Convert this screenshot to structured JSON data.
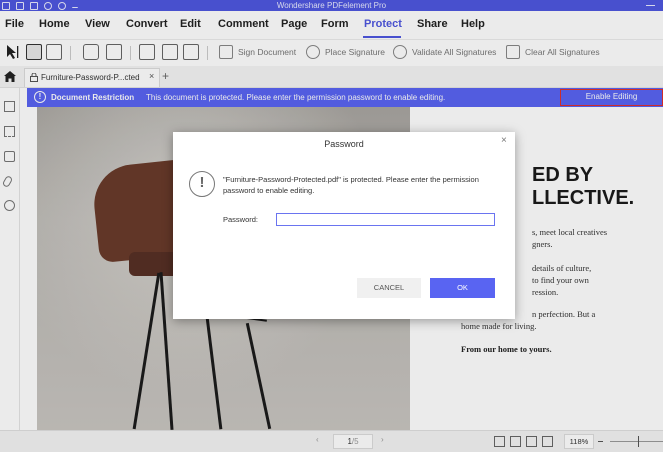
{
  "app": {
    "title": "Wondershare PDFelement Pro"
  },
  "menu": [
    {
      "label": "File"
    },
    {
      "label": "Home"
    },
    {
      "label": "View"
    },
    {
      "label": "Convert"
    },
    {
      "label": "Edit"
    },
    {
      "label": "Comment"
    },
    {
      "label": "Page"
    },
    {
      "label": "Form"
    },
    {
      "label": "Protect",
      "active": true
    },
    {
      "label": "Share"
    },
    {
      "label": "Help"
    }
  ],
  "toolbar": {
    "sign_document": "Sign Document",
    "place_signature": "Place Signature",
    "validate_all": "Validate All Signatures",
    "clear_all": "Clear All Signatures"
  },
  "tabs": {
    "doc_name": "Furniture-Password-P...cted",
    "close": "×",
    "add": "+"
  },
  "restriction": {
    "icon": "!",
    "title": "Document Restriction",
    "message": "This document is protected. Please enter the permission password to enable editing.",
    "button": "Enable Editing",
    "accent": "#5964f2"
  },
  "document": {
    "headline_1": "ED BY",
    "headline_2": "LLECTIVE.",
    "para_1_line_1": "s, meet local creatives",
    "para_1_line_2": "gners.",
    "para_2_line_1": "details of culture,",
    "para_2_line_2": "to find your own",
    "para_2_line_3": "ression.",
    "para_3_line_1": "n perfection. But a",
    "para_3_line_2": "home made for living.",
    "para_4": "From our home to yours."
  },
  "status": {
    "prev": "‹",
    "page_current": "1",
    "page_total": "/5",
    "next": "›",
    "zoom": "118%",
    "zoom_minus": "–"
  },
  "dialog": {
    "title": "Password",
    "close": "×",
    "warn_icon": "!",
    "message": "\"Furniture-Password-Protected.pdf\" is protected. Please enter the permission password to enable editing.",
    "password_label": "Password:",
    "password_value": "",
    "cancel": "CANCEL",
    "ok": "OK"
  }
}
